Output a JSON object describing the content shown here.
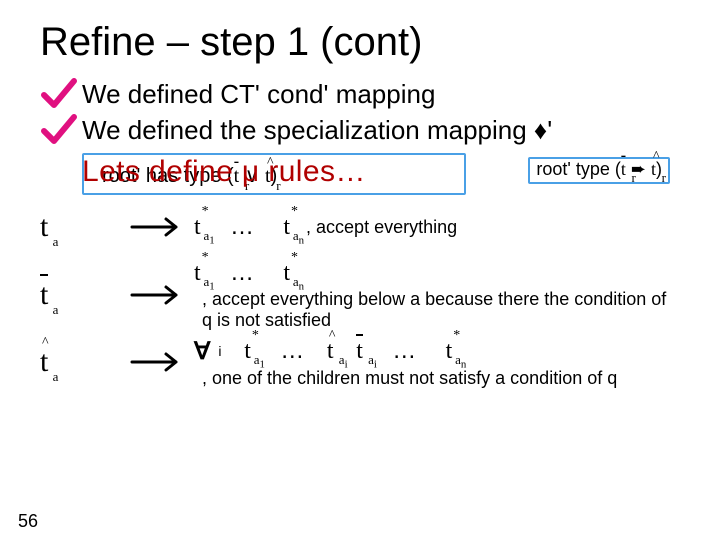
{
  "title": "Refine – step 1 (cont)",
  "bullets": [
    {
      "text": "We defined CT' cond' mapping"
    },
    {
      "text": "We defined the specialization mapping "
    }
  ],
  "bullet2_tail": "♦'",
  "under_text_pre": "root' has type (",
  "under_text_mid": " ∨ ",
  "under_text_post": ")",
  "over_text": "Lets define μ rules…",
  "badge_pre": "root' type (",
  "badge_mid": " ➨ ",
  "badge_post": ")",
  "t": "t",
  "dots": "…",
  "rule1": {
    "expl": ", accept everything"
  },
  "rule2": {
    "expl": ", accept everything below a because there the condition of q is not satisfied"
  },
  "rule3": {
    "forall": "∀",
    "sub_i": "i",
    "expl": ", one of the children must not satisfy a condition of q"
  },
  "subs": {
    "a": "a",
    "r": "r",
    "a1": "a",
    "an": "a",
    "ai": "a",
    "n1": "1",
    "nn": "n",
    "ni": "i"
  },
  "page": "56"
}
